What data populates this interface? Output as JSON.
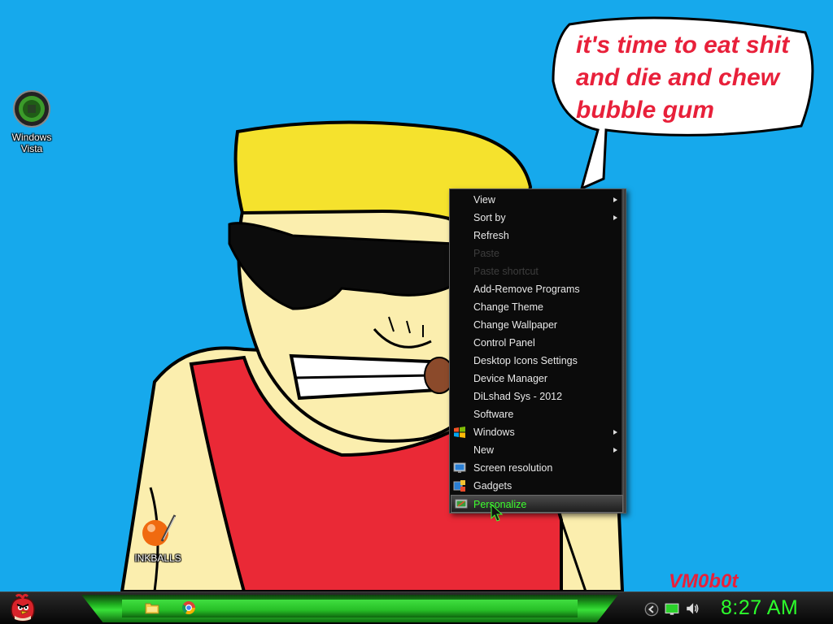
{
  "desktop": {
    "icons": [
      {
        "label_line1": "Windows",
        "label_line2": "Vista"
      },
      {
        "label": "INKBALLS"
      }
    ],
    "speech_bubble": {
      "line1": "it's time to eat shit",
      "line2": "and die and chew",
      "line3": "bubble gum"
    },
    "signature": "VM0b0t"
  },
  "context_menu": {
    "items": [
      {
        "label": "View",
        "submenu": true
      },
      {
        "label": "Sort by",
        "submenu": true
      },
      {
        "label": "Refresh"
      },
      {
        "label": "Paste",
        "disabled": true
      },
      {
        "label": "Paste shortcut",
        "disabled": true
      },
      {
        "label": "Add-Remove Programs"
      },
      {
        "label": "Change Theme"
      },
      {
        "label": "Change Wallpaper"
      },
      {
        "label": "Control Panel"
      },
      {
        "label": "Desktop Icons Settings"
      },
      {
        "label": "Device Manager"
      },
      {
        "label": "DiLshad Sys - 2012"
      },
      {
        "label": "Software"
      },
      {
        "label": "Windows",
        "submenu": true,
        "icon": "windows-logo-icon"
      },
      {
        "label": "New",
        "submenu": true
      },
      {
        "label": "Screen resolution",
        "icon": "monitor-icon"
      },
      {
        "label": "Gadgets",
        "icon": "gadgets-icon"
      },
      {
        "label": "Personalize",
        "icon": "personalize-icon",
        "highlighted": true
      }
    ]
  },
  "taskbar": {
    "clock": "8:27 AM"
  },
  "colors": {
    "desktop_bg": "#16a9ec",
    "accent_green": "#2cff2c",
    "speech_red": "#e8203a"
  }
}
